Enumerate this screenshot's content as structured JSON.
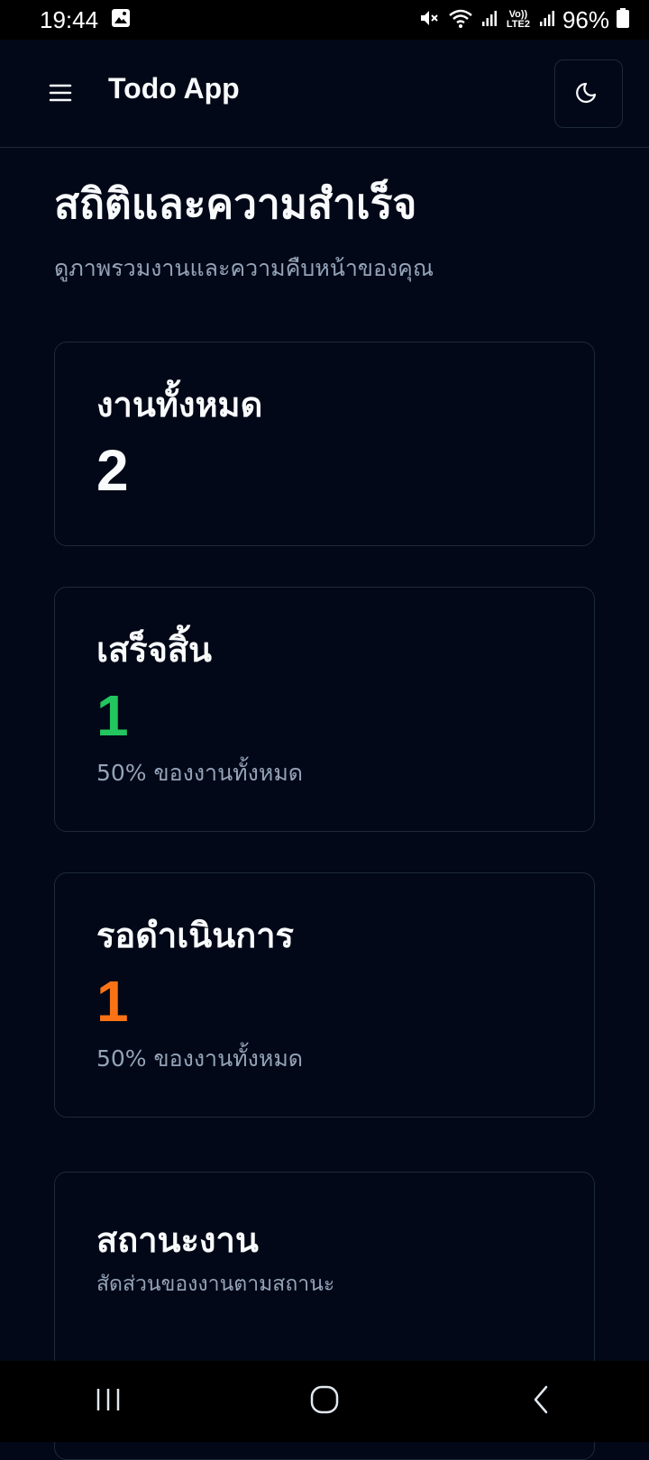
{
  "status_bar": {
    "time": "19:44",
    "network_label": "Vo)) LTE2",
    "battery_percent": "96%"
  },
  "app_bar": {
    "title": "Todo App",
    "menu_icon": "hamburger-menu-icon",
    "theme_icon": "moon-icon"
  },
  "page": {
    "title": "สถิติและความสำเร็จ",
    "subtitle": "ดูภาพรวมงานและความคืบหน้าของคุณ"
  },
  "cards": {
    "total": {
      "label": "งานทั้งหมด",
      "value": "2"
    },
    "completed": {
      "label": "เสร็จสิ้น",
      "value": "1",
      "note": "50% ของงานทั้งหมด",
      "color": "#22c55e"
    },
    "pending": {
      "label": "รอดำเนินการ",
      "value": "1",
      "note": "50% ของงานทั้งหมด",
      "color": "#f97316"
    },
    "status": {
      "label": "สถานะงาน",
      "note": "สัดส่วนของงานตามสถานะ"
    }
  },
  "nav_bar": {
    "recents_icon": "recents-icon",
    "home_icon": "home-icon",
    "back_icon": "back-icon"
  }
}
